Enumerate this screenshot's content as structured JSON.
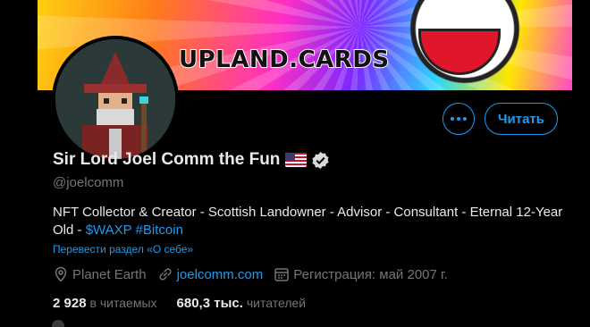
{
  "banner": {
    "text": "UPLAND.CARDS"
  },
  "profile": {
    "name": "Sir Lord Joel Comm the Fun",
    "flag_icon": "us-flag-icon",
    "verified_icon": "verified-badge-icon",
    "handle": "@joelcomm",
    "bio_text": "NFT Collector & Creator - Scottish Landowner - Advisor - Consultant - Eternal 12-Year Old - ",
    "bio_tags": [
      "$WAXP",
      "#Bitcoin"
    ],
    "translate_label": "Перевести раздел «О себе»",
    "location": "Planet Earth",
    "website": "joelcomm.com",
    "joined": "Регистрация: май 2007 г."
  },
  "actions": {
    "more_label": "More",
    "follow_label": "Читать"
  },
  "stats": {
    "following_count": "2 928",
    "following_label": "в читаемых",
    "followers_count": "680,3 тыс.",
    "followers_label": "читателей"
  },
  "colors": {
    "accent": "#1d9bf0",
    "background": "#000000",
    "muted": "#71767b"
  }
}
